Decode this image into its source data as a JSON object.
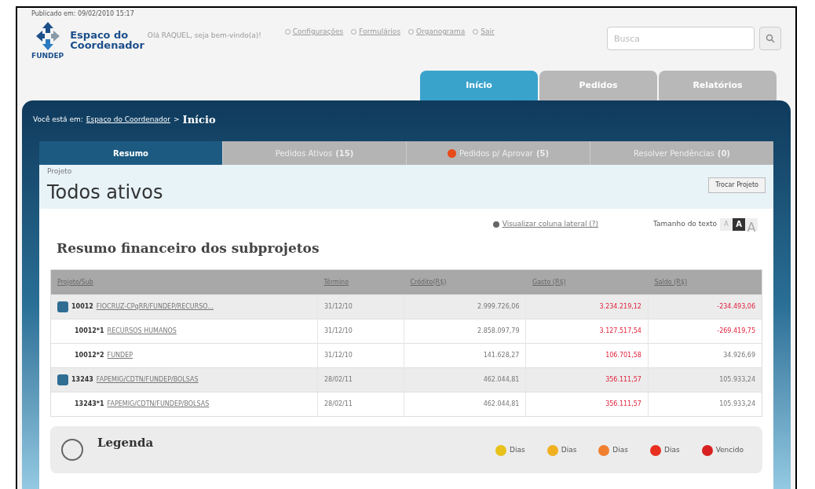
{
  "published": "Publicado em: 09/02/2010 15:17",
  "logo": {
    "brand": "FUNDEP",
    "title_1": "Espaco do",
    "title_2": "Coordenador"
  },
  "greeting": "Olá RAQUEL, seja bem-vindo(a)!",
  "top_links": [
    "Configurações",
    "Formulários",
    "Organograma",
    "Sair"
  ],
  "search": {
    "placeholder": "Busca"
  },
  "main_tabs": [
    {
      "label": "Início",
      "selected": true
    },
    {
      "label": "Pedidos",
      "selected": false
    },
    {
      "label": "Relatórios",
      "selected": false
    }
  ],
  "breadcrumb": {
    "prefix": "Você está em:",
    "link": "Espaço do Coordenador",
    "separator": ">",
    "current": "Início"
  },
  "sub_tabs": [
    {
      "label": "Resumo",
      "selected": true,
      "alert": false
    },
    {
      "label": "Pedidos Ativos",
      "count": "(15)",
      "selected": false,
      "alert": false
    },
    {
      "label": "Pedidos p/ Aprovar",
      "count": "(5)",
      "selected": false,
      "alert": true
    },
    {
      "label": "Resolver Pendências",
      "count": "(0)",
      "selected": false,
      "alert": false
    }
  ],
  "project": {
    "label": "Projeto",
    "name": "Todos ativos",
    "button": "Trocar Projeto"
  },
  "side_column_link": "Visualizar coluna lateral (?)",
  "text_size": {
    "label": "Tamanho do texto",
    "options": [
      {
        "label": "A",
        "selected": false
      },
      {
        "label": "A",
        "selected": true
      },
      {
        "label": "A",
        "selected": false
      }
    ]
  },
  "section_title": "Resumo financeiro dos subprojetos",
  "table": {
    "columns": [
      "Projeto/Sub",
      "Término",
      "Crédito(R$)",
      "Gasto (R$)",
      "Saldo (R$)"
    ],
    "rows": [
      {
        "kind": "group",
        "code": "10012",
        "name": "FIOCRUZ-CPqRR/FUNDEP/RECURSO...",
        "end": "31/12/10",
        "credit": "2.999.726,06",
        "spent": "3.234.219,12",
        "spent_alert": true,
        "balance": "-234.493,06",
        "balance_alert": true
      },
      {
        "kind": "sub",
        "code": "10012*1",
        "name": "RECURSOS HUMANOS",
        "end": "31/12/10",
        "credit": "2.858.097,79",
        "spent": "3.127.517,54",
        "spent_alert": true,
        "balance": "-269.419,75",
        "balance_alert": true
      },
      {
        "kind": "sub",
        "code": "10012*2",
        "name": "FUNDEP",
        "end": "31/12/10",
        "credit": "141.628,27",
        "spent": "106.701,58",
        "spent_alert": true,
        "balance": "34.926,69",
        "balance_alert": false
      },
      {
        "kind": "group",
        "code": "13243",
        "name": "FAPEMIG/CDTN/FUNDEP/BOLSAS",
        "end": "28/02/11",
        "credit": "462.044,81",
        "spent": "356.111,57",
        "spent_alert": true,
        "balance": "105.933,24",
        "balance_alert": false
      },
      {
        "kind": "sub",
        "code": "13243*1",
        "name": "FAPEMIG/CDTN/FUNDEP/BOLSAS",
        "end": "28/02/11",
        "credit": "462.044,81",
        "spent": "356.111,57",
        "spent_alert": true,
        "balance": "105.933,24",
        "balance_alert": false
      }
    ]
  },
  "legend": {
    "title": "Legenda",
    "items": [
      {
        "label": "Dias",
        "color": "#e8c21a"
      },
      {
        "label": "Dias",
        "color": "#f0b020"
      },
      {
        "label": "Dias",
        "color": "#f08030"
      },
      {
        "label": "Dias",
        "color": "#e83020"
      },
      {
        "label": "Vencido",
        "color": "#d82020"
      }
    ]
  }
}
